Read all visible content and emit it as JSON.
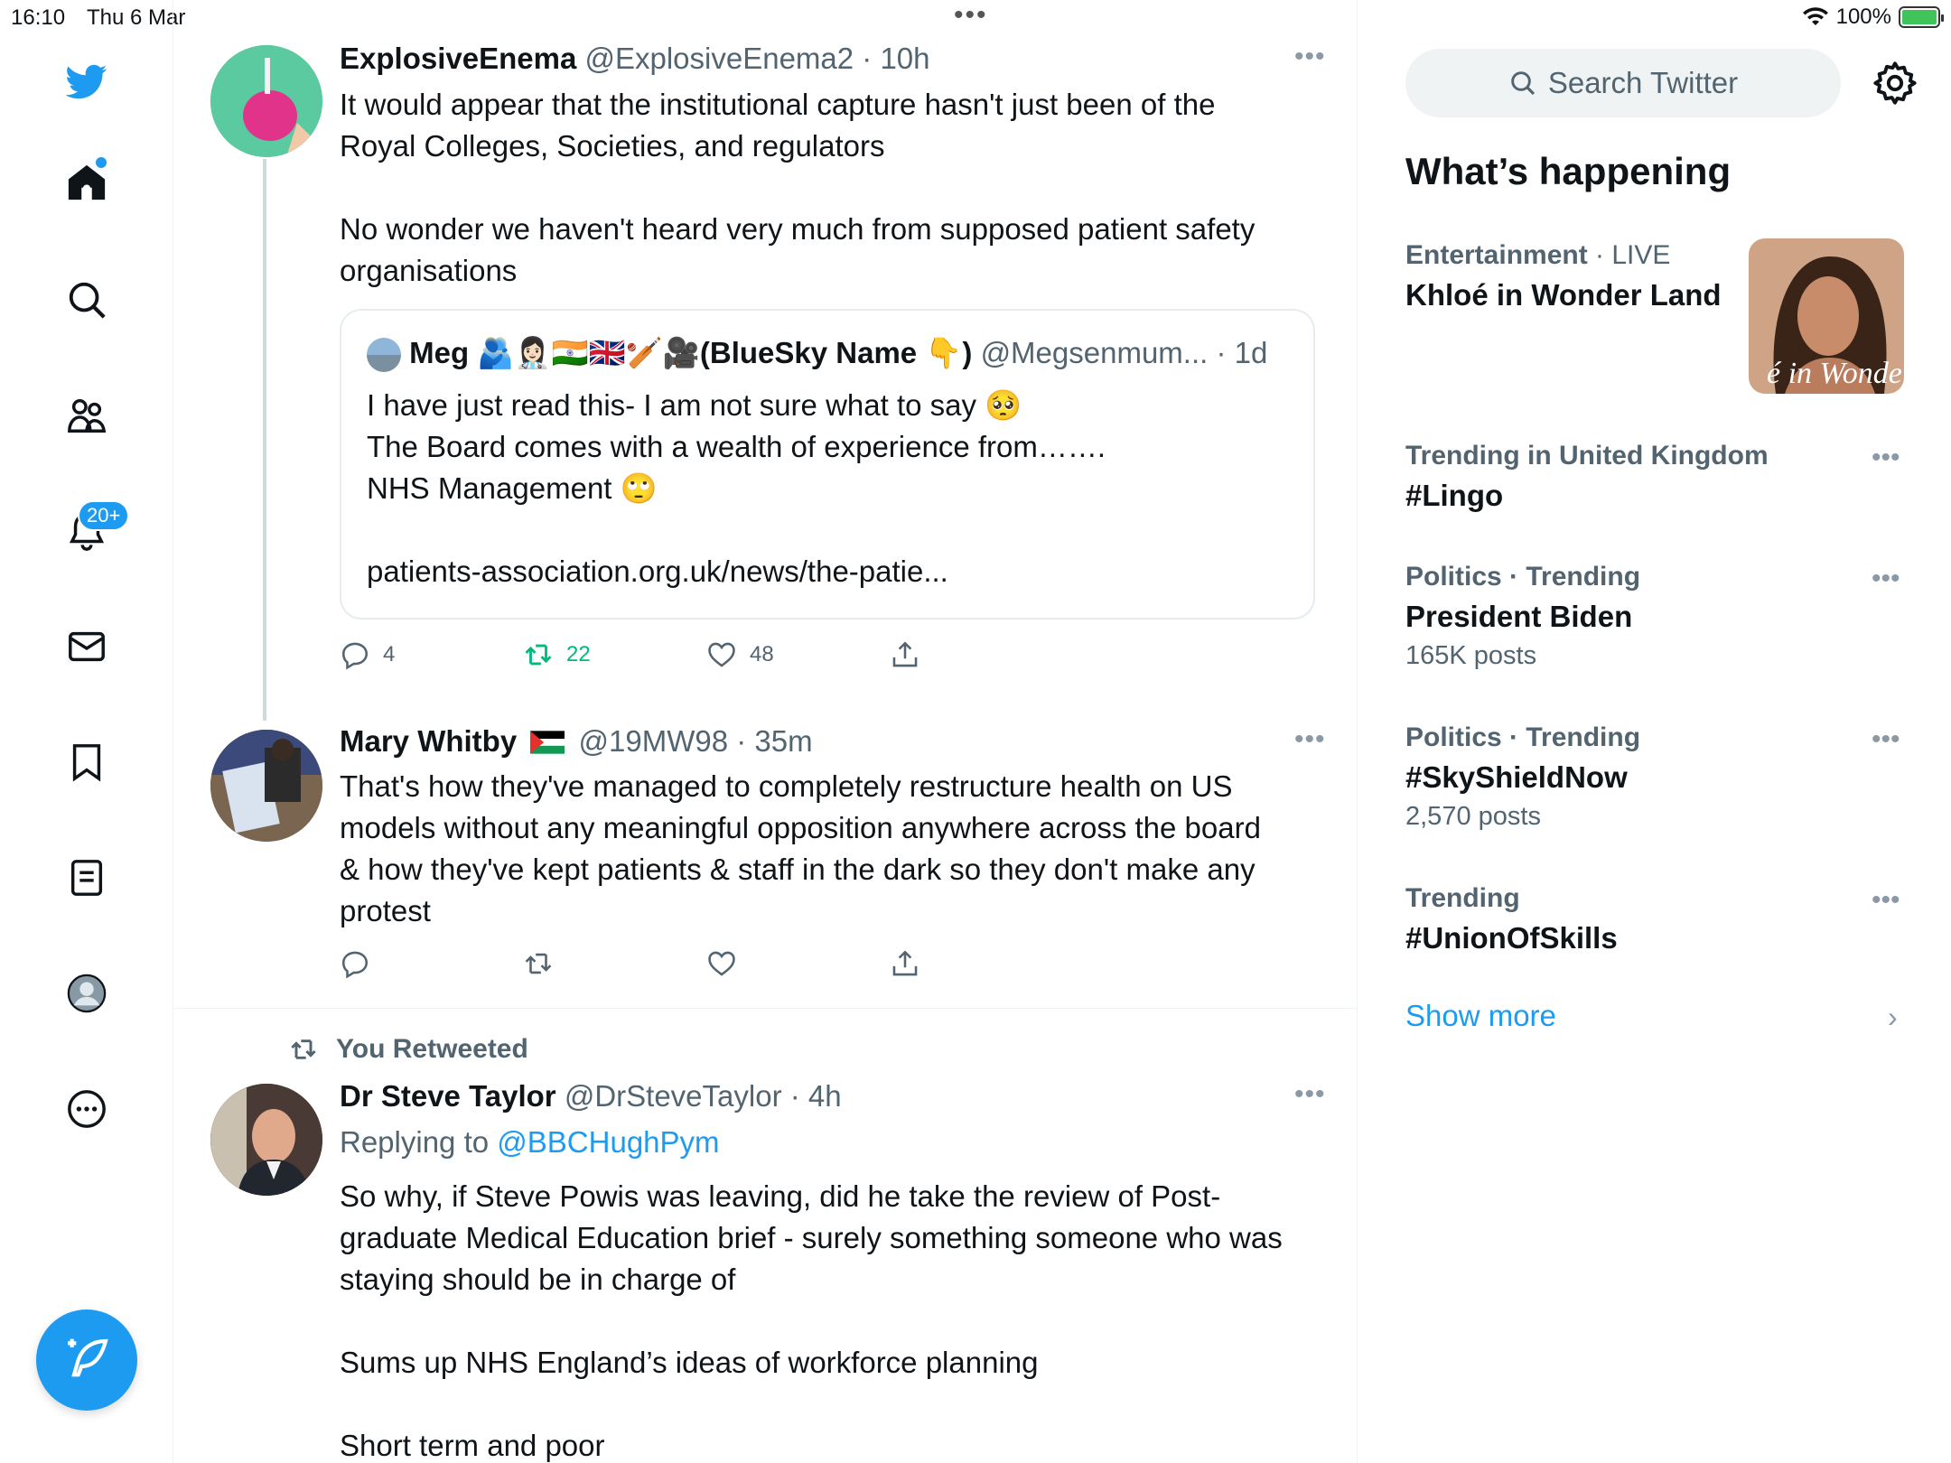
{
  "status": {
    "time": "16:10",
    "date": "Thu 6 Mar",
    "dots": "•••",
    "battery": "100%"
  },
  "nav": {
    "notifications_badge": "20+"
  },
  "tweets": [
    {
      "name": "ExplosiveEnema",
      "meta": "@ExplosiveEnema2 · 10h",
      "text": "It would appear that the institutional capture hasn't just been of the\nRoyal Colleges, Societies, and regulators\n\nNo wonder we haven't heard very much from supposed patient safety\norganisations",
      "quote": {
        "name": "Meg 🫂👩🏻‍⚕️🇮🇳🇬🇧🏏🎥(BlueSky Name 👇)",
        "meta": "@Megsenmum... · 1d",
        "text": "I have just read this- I am not sure what to say 🥺\nThe Board comes with a wealth of experience from…….\nNHS Management 🙄\n\npatients-association.org.uk/news/the-patie..."
      },
      "reply_count": "4",
      "retweet_count": "22",
      "like_count": "48"
    },
    {
      "name": "Mary Whitby",
      "meta": "@19MW98 · 35m",
      "text": "That's how they've managed to completely restructure health on US\nmodels without any meaningful opposition anywhere across the board\n& how they've kept patients & staff in the dark so they don't make any\nprotest"
    },
    {
      "retweeted_label": "You Retweeted",
      "name": "Dr Steve Taylor",
      "meta": "@DrSteveTaylor · 4h",
      "replying_prefix": "Replying to",
      "replying_to": "@BBCHughPym",
      "text": "So why, if Steve Powis was leaving, did he take the review of Post-\ngraduate Medical Education brief - surely something someone who was\nstaying should be in charge of\n\nSums up NHS England’s ideas of workforce planning\n\nShort term and poor"
    }
  ],
  "sidebar": {
    "search_placeholder": "Search Twitter",
    "heading": "What’s happening",
    "trends": [
      {
        "category": "Entertainment",
        "context": " · LIVE",
        "title": "Khloé in Wonder Land",
        "image_caption": "é in Wonder L"
      },
      {
        "context": "Trending in United Kingdom",
        "title": "#Lingo"
      },
      {
        "context": "Politics · Trending",
        "title": "President Biden",
        "count": "165K posts"
      },
      {
        "context": "Politics · Trending",
        "title": "#SkyShieldNow",
        "count": "2,570 posts"
      },
      {
        "context": "Trending",
        "title": "#UnionOfSkills"
      }
    ],
    "show_more": "Show more"
  },
  "colors": {
    "accent": "#1d9bf0",
    "retweet": "#00ba7c",
    "muted": "#536471"
  }
}
